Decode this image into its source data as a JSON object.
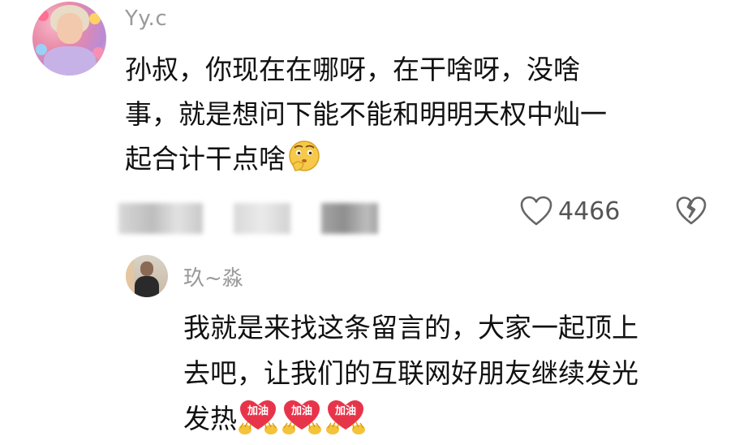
{
  "comment": {
    "username": "Yy.c",
    "line1": "孙叔，你现在在哪呀，在干啥呀，没啥",
    "line2": "事，就是想问下能不能和明明天权中灿一",
    "line3": "起合计干点啥",
    "likes": "4466"
  },
  "reply": {
    "username": "玖~淼",
    "line1": "我就是来找这条留言的，大家一起顶上",
    "line2": "去吧，让我们的互联网好朋友继续发光",
    "line3": "发热",
    "sticker_label": "加油"
  },
  "colors": {
    "username": "#9a9a9a",
    "text": "#111111",
    "icon": "#666666",
    "sticker_red": "#e8344a",
    "sticker_yellow": "#f4c33a"
  },
  "icons": {
    "like": "heart-outline-icon",
    "dislike": "broken-heart-icon",
    "emoji": "thinking-emoji-icon",
    "sticker": "jiayou-sticker-icon"
  }
}
